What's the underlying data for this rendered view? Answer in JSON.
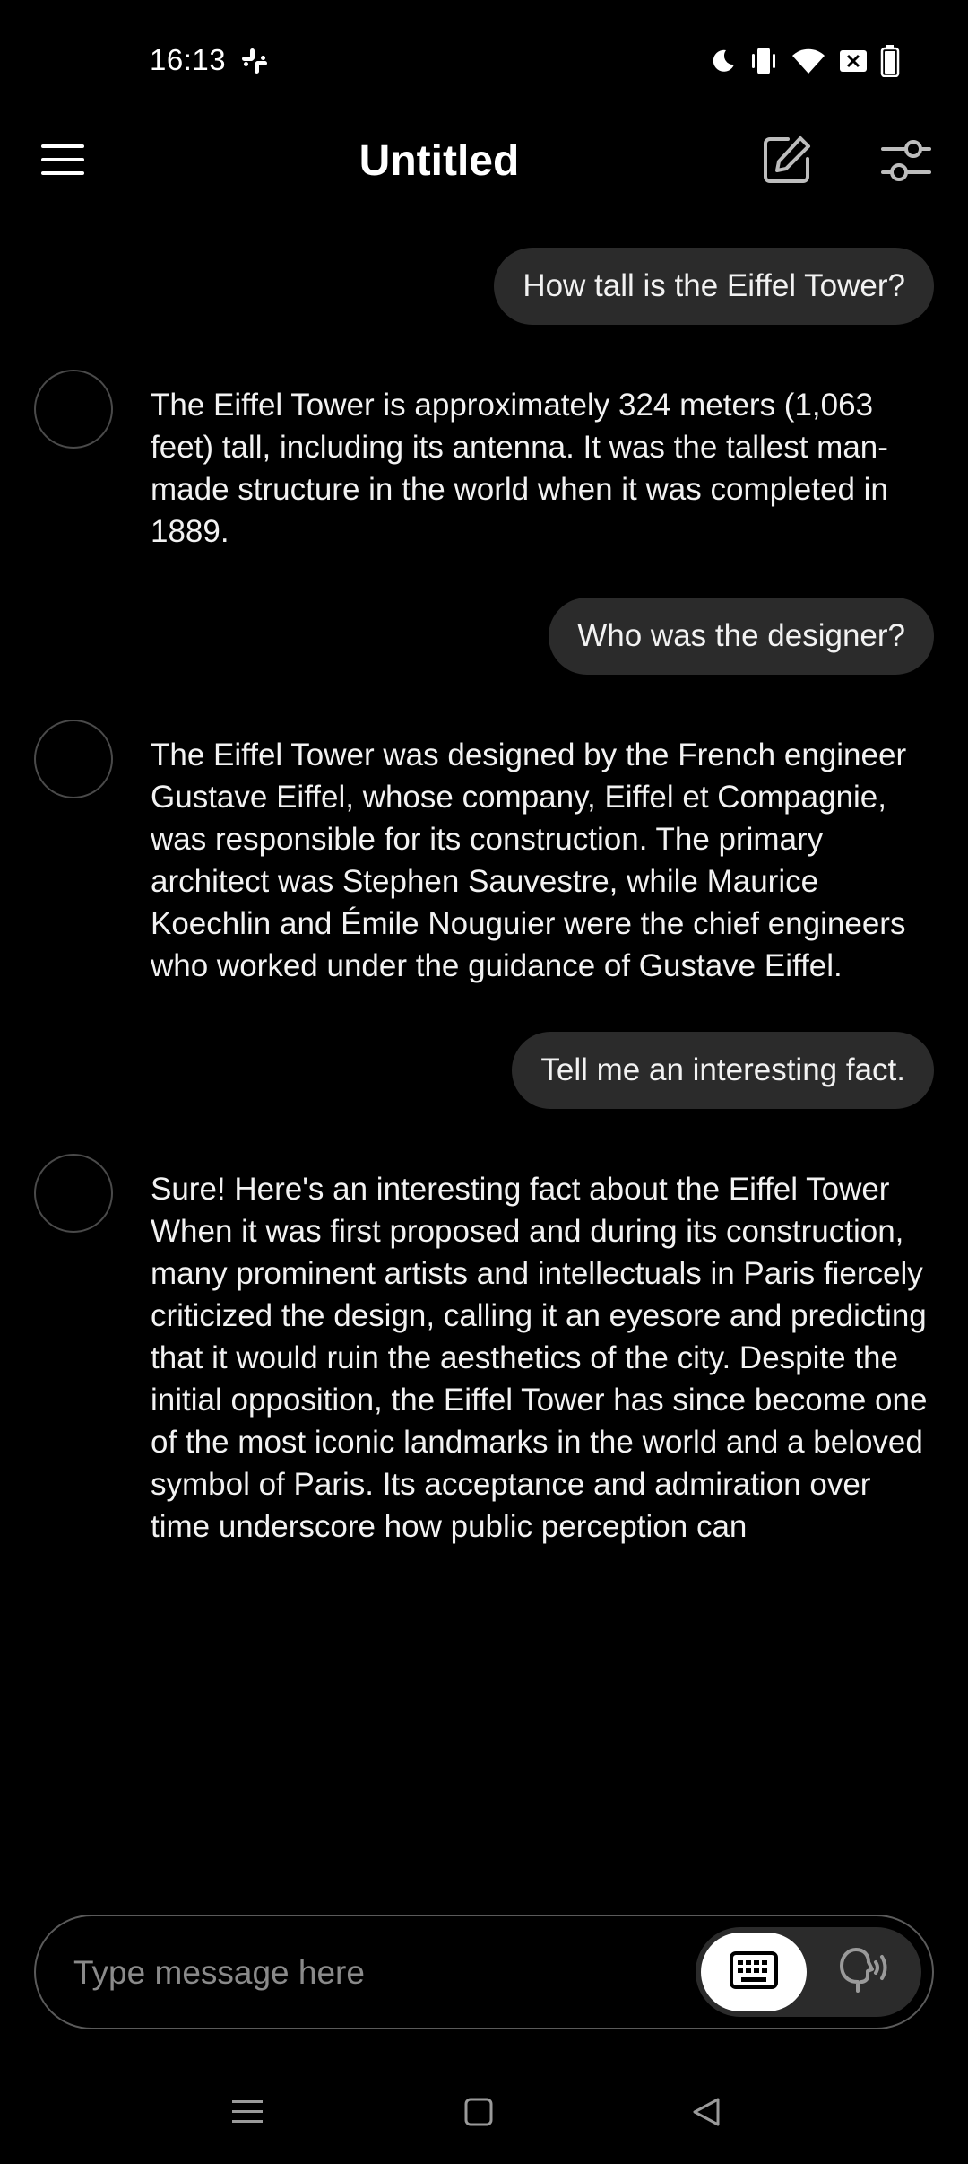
{
  "status_bar": {
    "time": "16:13",
    "icons": [
      "slack-icon",
      "moon-icon",
      "vibrate-icon",
      "wifi-icon",
      "no-sim-icon",
      "battery-icon"
    ]
  },
  "header": {
    "title": "Untitled",
    "menu_icon": "hamburger-icon",
    "edit_icon": "edit-icon",
    "settings_icon": "sliders-icon"
  },
  "messages": [
    {
      "role": "user",
      "text": "How tall is the Eiffel Tower?"
    },
    {
      "role": "assistant",
      "text": "The Eiffel Tower is approximately 324 meters (1,063 feet) tall, including its antenna. It was the tallest man-made structure in the world when it was completed in 1889."
    },
    {
      "role": "user",
      "text": "Who was the designer?"
    },
    {
      "role": "assistant",
      "text": "The Eiffel Tower was designed by the French engineer Gustave Eiffel, whose company, Eiffel et Compagnie, was responsible for its construction. The primary architect was Stephen Sauvestre, while Maurice Koechlin and Émile Nouguier were the chief engineers who worked under the guidance of Gustave Eiffel."
    },
    {
      "role": "user",
      "text": "Tell me an interesting fact."
    },
    {
      "role": "assistant",
      "text": "Sure! Here's an interesting fact about the Eiffel Tower When it was first proposed and during its construction, many prominent artists and intellectuals in Paris fiercely criticized the design, calling it an eyesore and predicting that it would ruin the aesthetics of the city. Despite the initial opposition, the Eiffel Tower has since become one of the most iconic landmarks in the world and a beloved symbol of Paris. Its acceptance and admiration over time underscore how public perception can"
    }
  ],
  "composer": {
    "placeholder": "Type message here",
    "value": "",
    "keyboard_icon": "keyboard-icon",
    "voice_icon": "voice-icon",
    "selected_mode": "keyboard"
  },
  "nav_bar": {
    "icons": [
      "recents-icon",
      "home-icon",
      "back-icon"
    ]
  },
  "colors": {
    "background": "#000000",
    "bubble": "#2b2b2b",
    "text": "#f2f2f2",
    "placeholder": "#8a8a8a",
    "border": "#5a5a5a"
  }
}
